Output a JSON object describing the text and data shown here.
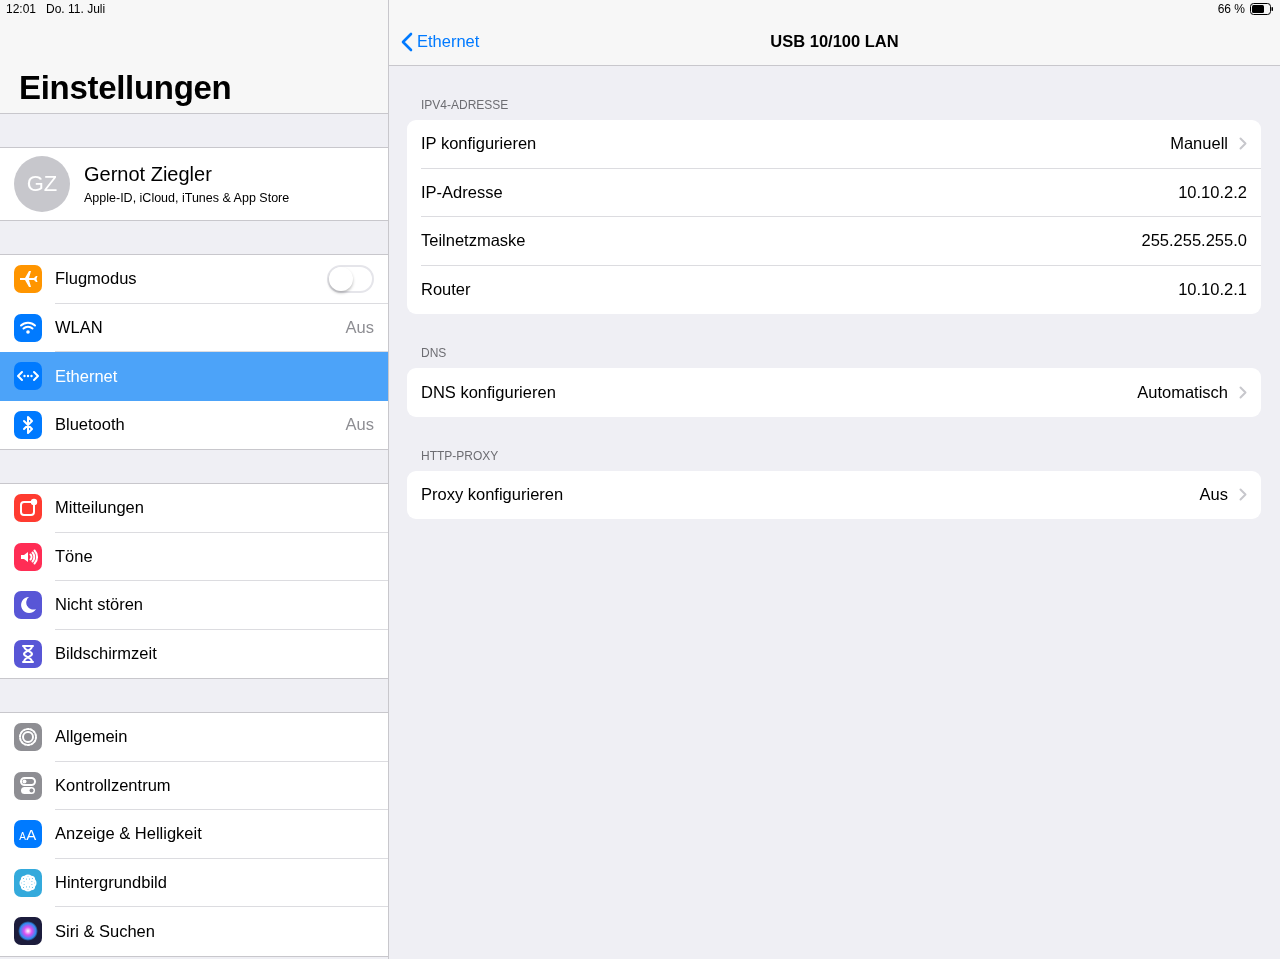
{
  "status_bar": {
    "time": "12:01",
    "date": "Do. 11. Juli",
    "battery": "66 %"
  },
  "sidebar": {
    "title": "Einstellungen",
    "profile": {
      "initials": "GZ",
      "name": "Gernot Ziegler",
      "subtitle": "Apple-ID, iCloud, iTunes & App Store"
    },
    "groups": [
      {
        "items": [
          {
            "label": "Flugmodus",
            "kind": "toggle",
            "on": false,
            "selected": false,
            "color": "#ff9500"
          },
          {
            "label": "WLAN",
            "kind": "value",
            "value": "Aus",
            "selected": false,
            "color": "#007aff"
          },
          {
            "label": "Ethernet",
            "kind": "link",
            "selected": true,
            "color": "#007aff"
          },
          {
            "label": "Bluetooth",
            "kind": "value",
            "value": "Aus",
            "selected": false,
            "color": "#007aff"
          }
        ]
      },
      {
        "items": [
          {
            "label": "Mitteilungen",
            "kind": "link",
            "selected": false,
            "color": "#ff3b30"
          },
          {
            "label": "Töne",
            "kind": "link",
            "selected": false,
            "color": "#ff2d55"
          },
          {
            "label": "Nicht stören",
            "kind": "link",
            "selected": false,
            "color": "#5856d6"
          },
          {
            "label": "Bildschirmzeit",
            "kind": "link",
            "selected": false,
            "color": "#5856d6"
          }
        ]
      },
      {
        "items": [
          {
            "label": "Allgemein",
            "kind": "link",
            "selected": false,
            "color": "#8e8e93"
          },
          {
            "label": "Kontrollzentrum",
            "kind": "link",
            "selected": false,
            "color": "#8e8e93"
          },
          {
            "label": "Anzeige & Helligkeit",
            "kind": "link",
            "selected": false,
            "color": "#007aff",
            "icon_text": "AA"
          },
          {
            "label": "Hintergrundbild",
            "kind": "link",
            "selected": false,
            "color": "#34aadc"
          },
          {
            "label": "Siri & Suchen",
            "kind": "link",
            "selected": false,
            "color": "#1c1c3c"
          }
        ]
      }
    ]
  },
  "detail": {
    "back_label": "Ethernet",
    "title": "USB 10/100 LAN",
    "sections": [
      {
        "header": "IPV4-ADRESSE",
        "rows": [
          {
            "label": "IP konfigurieren",
            "value": "Manuell",
            "kind": "disclosure"
          },
          {
            "label": "IP-Adresse",
            "value": "10.10.2.2",
            "kind": "info"
          },
          {
            "label": "Teilnetzmaske",
            "value": "255.255.255.0",
            "kind": "info"
          },
          {
            "label": "Router",
            "value": "10.10.2.1",
            "kind": "info"
          }
        ]
      },
      {
        "header": "DNS",
        "rows": [
          {
            "label": "DNS konfigurieren",
            "value": "Automatisch",
            "kind": "disclosure"
          }
        ]
      },
      {
        "header": "HTTP-PROXY",
        "rows": [
          {
            "label": "Proxy konfigurieren",
            "value": "Aus",
            "kind": "disclosure"
          }
        ]
      }
    ]
  }
}
